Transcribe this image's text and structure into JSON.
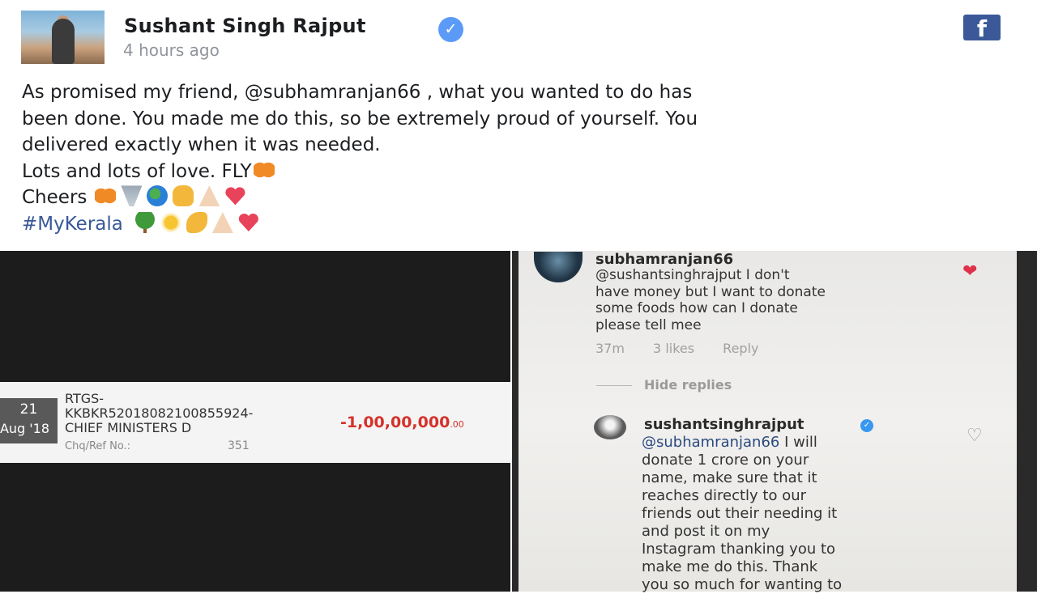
{
  "post": {
    "author": "Sushant Singh Rajput",
    "timestamp": "4 hours ago",
    "lines": [
      "As promised my friend, @subhamranjan66 , what you wanted to do has",
      "been done. You made me do this, so be extremely proud of yourself. You",
      "delivered exactly when it was needed.",
      "Lots and lots of love. FLY",
      "Cheers",
      "#MyKerala"
    ]
  },
  "bank": {
    "day": "21",
    "month_year": "Aug '18",
    "desc_lines": [
      "RTGS-",
      "KKBKR52018082100855924-",
      "CHIEF MINISTERS D"
    ],
    "ref_label": "Chq/Ref No.:",
    "ref_value": "351",
    "amount": "-1,00,00,000",
    "amount_decimals": ".00"
  },
  "instagram": {
    "comment1": {
      "user": "subhamranjan66",
      "lines": [
        "@sushantsinghrajput I don't",
        "have money but I want to donate",
        "some foods how can I donate",
        "please tell mee"
      ],
      "time": "37m",
      "likes": "3 likes",
      "reply": "Reply"
    },
    "hide_replies": "Hide replies",
    "comment2": {
      "user": "sushantsinghrajput",
      "mention": "@subhamranjan66",
      "first_line_rest": " I will",
      "lines": [
        "donate 1 crore on your",
        "name, make sure that it",
        "reaches directly to our",
        "friends out their needing it",
        "and post it on my",
        "Instagram thanking you to",
        "make me do this. Thank",
        "you so much for wanting to"
      ]
    }
  },
  "colors": {
    "facebook_blue": "#3b5998",
    "hashtag": "#385898",
    "amount_red": "#d5312b"
  },
  "icons": [
    "verified-badge-icon",
    "facebook-logo-icon",
    "butterfly-emoji",
    "tornado-emoji",
    "globe-emoji",
    "fist-emoji",
    "pray-emoji",
    "heart-emoji",
    "tree-emoji",
    "sun-emoji",
    "muscle-emoji",
    "heart-icon",
    "heart-outline-icon"
  ]
}
